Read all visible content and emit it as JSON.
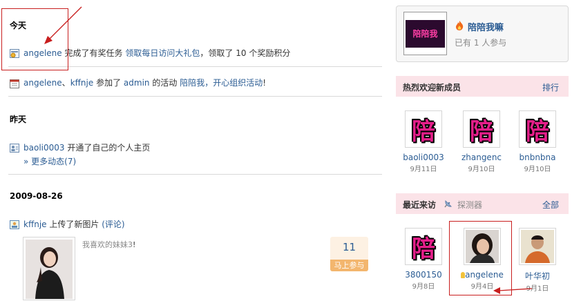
{
  "feed": {
    "today": {
      "heading": "今天",
      "task": {
        "user": "angelene",
        "text1": "完成了有奖任务",
        "task_link": "领取每日访问大礼包",
        "text2": "，领取了",
        "count": "10",
        "text3": "个奖励积分"
      },
      "activity": {
        "user1": "angelene",
        "sep": "、",
        "user2": "kffnje",
        "text1": "参加了",
        "admin": "admin",
        "text2": "的活动",
        "activity_link": "陪陪我，开心组织活动",
        "bang": "!"
      }
    },
    "yesterday": {
      "heading": "昨天",
      "item": {
        "user": "baoli0003",
        "text": "开通了自己的个人主页"
      },
      "more": "» 更多动态(7)"
    },
    "date_group": {
      "heading": "2009-08-26",
      "item": {
        "user": "kffnje",
        "text": "上传了新图片",
        "comment": "(评论)"
      },
      "photo_caption": "我喜欢的妹妹3",
      "photo_bang": "!",
      "vote_count": "11",
      "vote_button": "马上参与"
    }
  },
  "sidebar": {
    "event_card": {
      "title": "陪陪我嘛",
      "participants": "已有 1 人参与",
      "logo_text": "陪陪我"
    },
    "new_members": {
      "title": "热烈欢迎新成员",
      "more": "排行",
      "members": [
        {
          "name": "baoli0003",
          "date": "9月11日"
        },
        {
          "name": "zhangenc",
          "date": "9月10日"
        },
        {
          "name": "bnbnbna",
          "date": "9月10日"
        }
      ]
    },
    "recent_visitors": {
      "title": "最近来访",
      "detector": "探测器",
      "more": "全部",
      "visitors": [
        {
          "name": "3800150",
          "date": "9月8日"
        },
        {
          "name": "angelene",
          "date": "9月4日"
        },
        {
          "name": "叶华初",
          "date": "9月1日"
        }
      ]
    },
    "avatar_glyph": "陪"
  },
  "colors": {
    "link": "#2b5c93",
    "annotation": "#c81e1e",
    "panel_head": "#fbe3e8"
  }
}
